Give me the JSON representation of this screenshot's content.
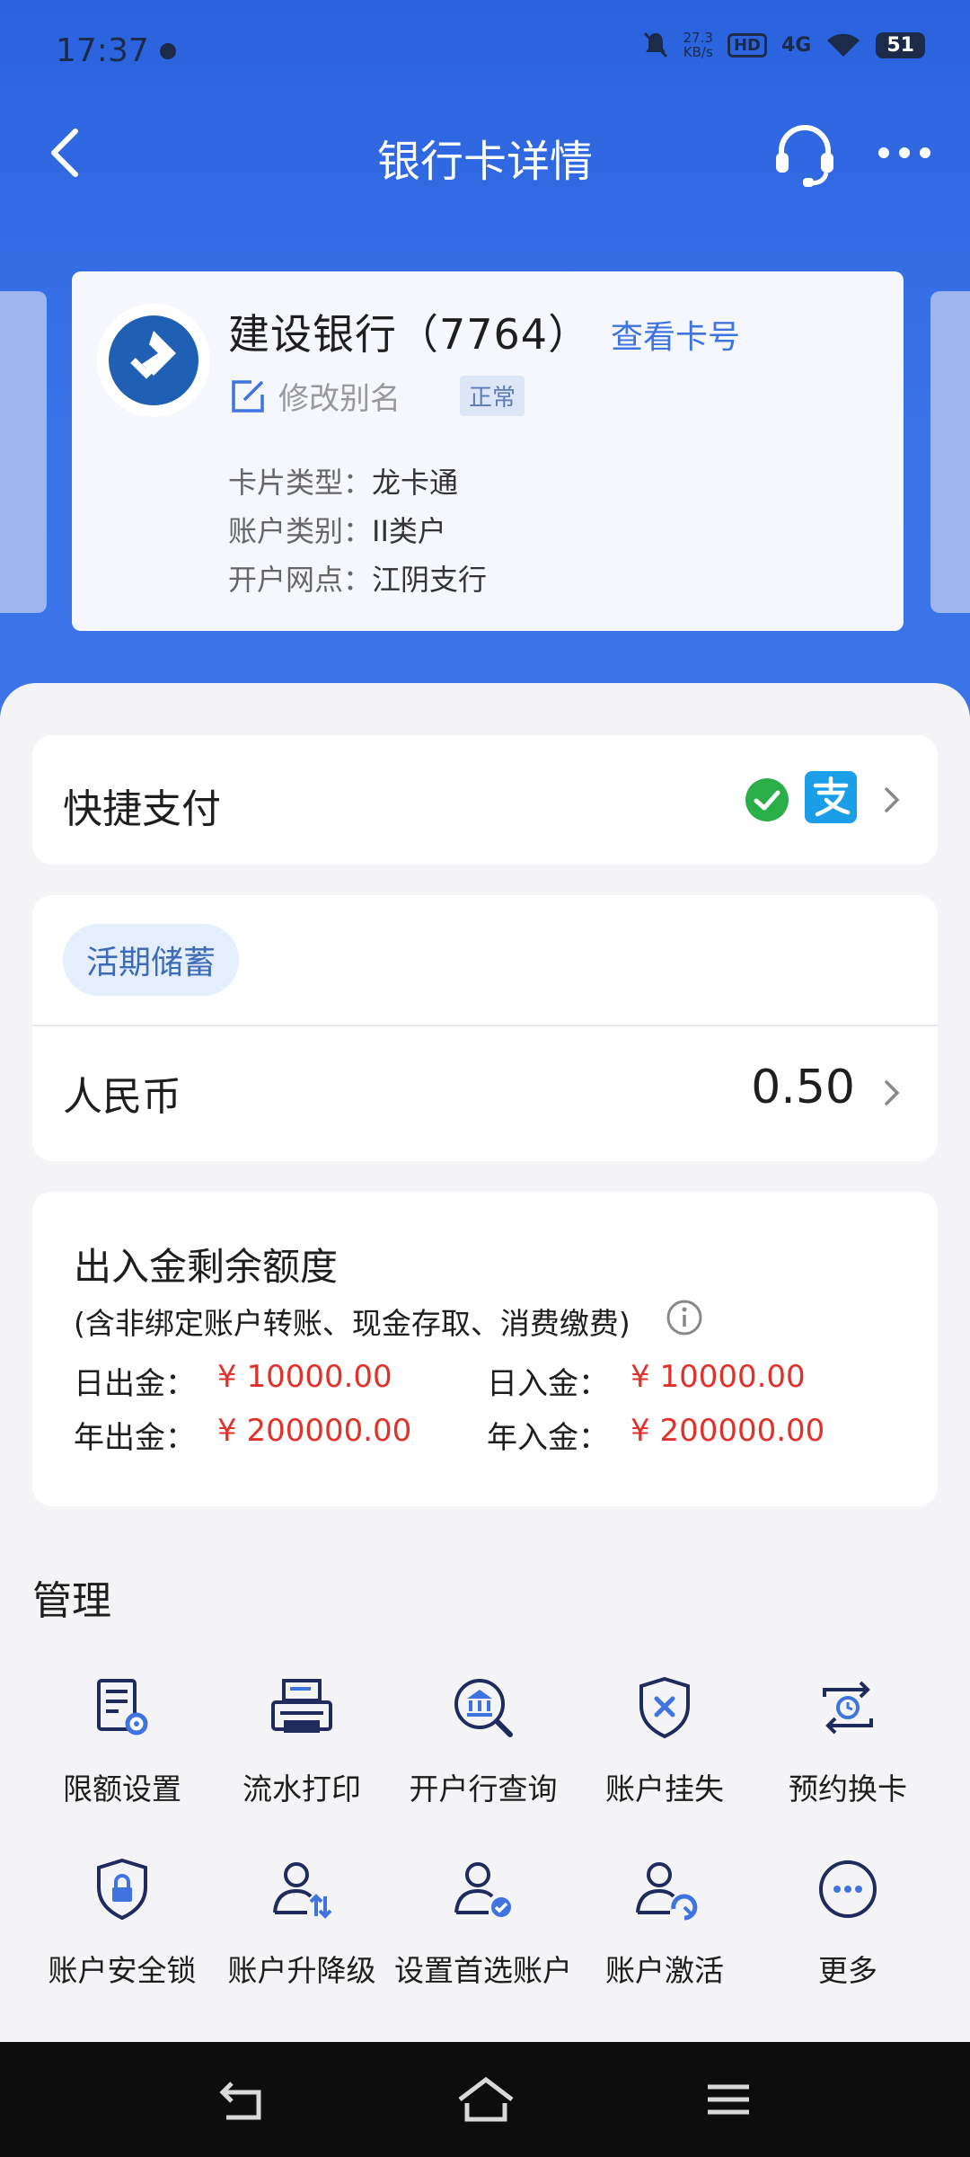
{
  "status_bar": {
    "time": "17:37",
    "netspeed_value": "27.3",
    "netspeed_unit": "KB/s",
    "hd": "HD",
    "signal": "4G",
    "battery": "51"
  },
  "header": {
    "title": "银行卡详情"
  },
  "card": {
    "name": "建设银行（7764）",
    "view_card_no": "查看卡号",
    "edit_alias": "修改别名",
    "status": "正常",
    "info": [
      {
        "key": "卡片类型：",
        "value": "龙卡通"
      },
      {
        "key": "账户类别：",
        "value": "II类户"
      },
      {
        "key": "开户网点：",
        "value": "江阴支行"
      }
    ]
  },
  "quickpay": {
    "label": "快捷支付"
  },
  "savings": {
    "tag": "活期储蓄",
    "currency": "人民币",
    "balance": "0.50"
  },
  "limits": {
    "title": "出入金剩余额度",
    "subtitle": "(含非绑定账户转账、现金存取、消费缴费)",
    "daily_out_label": "日出金：",
    "daily_out_value": "¥ 10000.00",
    "daily_in_label": "日入金：",
    "daily_in_value": "¥ 10000.00",
    "yearly_out_label": "年出金：",
    "yearly_out_value": "¥ 200000.00",
    "yearly_in_label": "年入金：",
    "yearly_in_value": "¥ 200000.00"
  },
  "management": {
    "title": "管理",
    "items": [
      {
        "label": "限额设置",
        "icon": "limit-settings-icon"
      },
      {
        "label": "流水打印",
        "icon": "printer-icon"
      },
      {
        "label": "开户行查询",
        "icon": "bank-search-icon"
      },
      {
        "label": "账户挂失",
        "icon": "shield-x-icon"
      },
      {
        "label": "预约换卡",
        "icon": "card-swap-icon"
      },
      {
        "label": "账户安全锁",
        "icon": "shield-lock-icon"
      },
      {
        "label": "账户升降级",
        "icon": "user-updown-icon"
      },
      {
        "label": "设置首选账户",
        "icon": "user-check-icon"
      },
      {
        "label": "账户激活",
        "icon": "user-activate-icon"
      },
      {
        "label": "更多",
        "icon": "more-circle-icon"
      }
    ]
  },
  "colors": {
    "primary": "#3a73e8",
    "accent_blue": "#3f74e0",
    "amount_red": "#e0322a",
    "icon_navy": "#1f2b5c"
  }
}
